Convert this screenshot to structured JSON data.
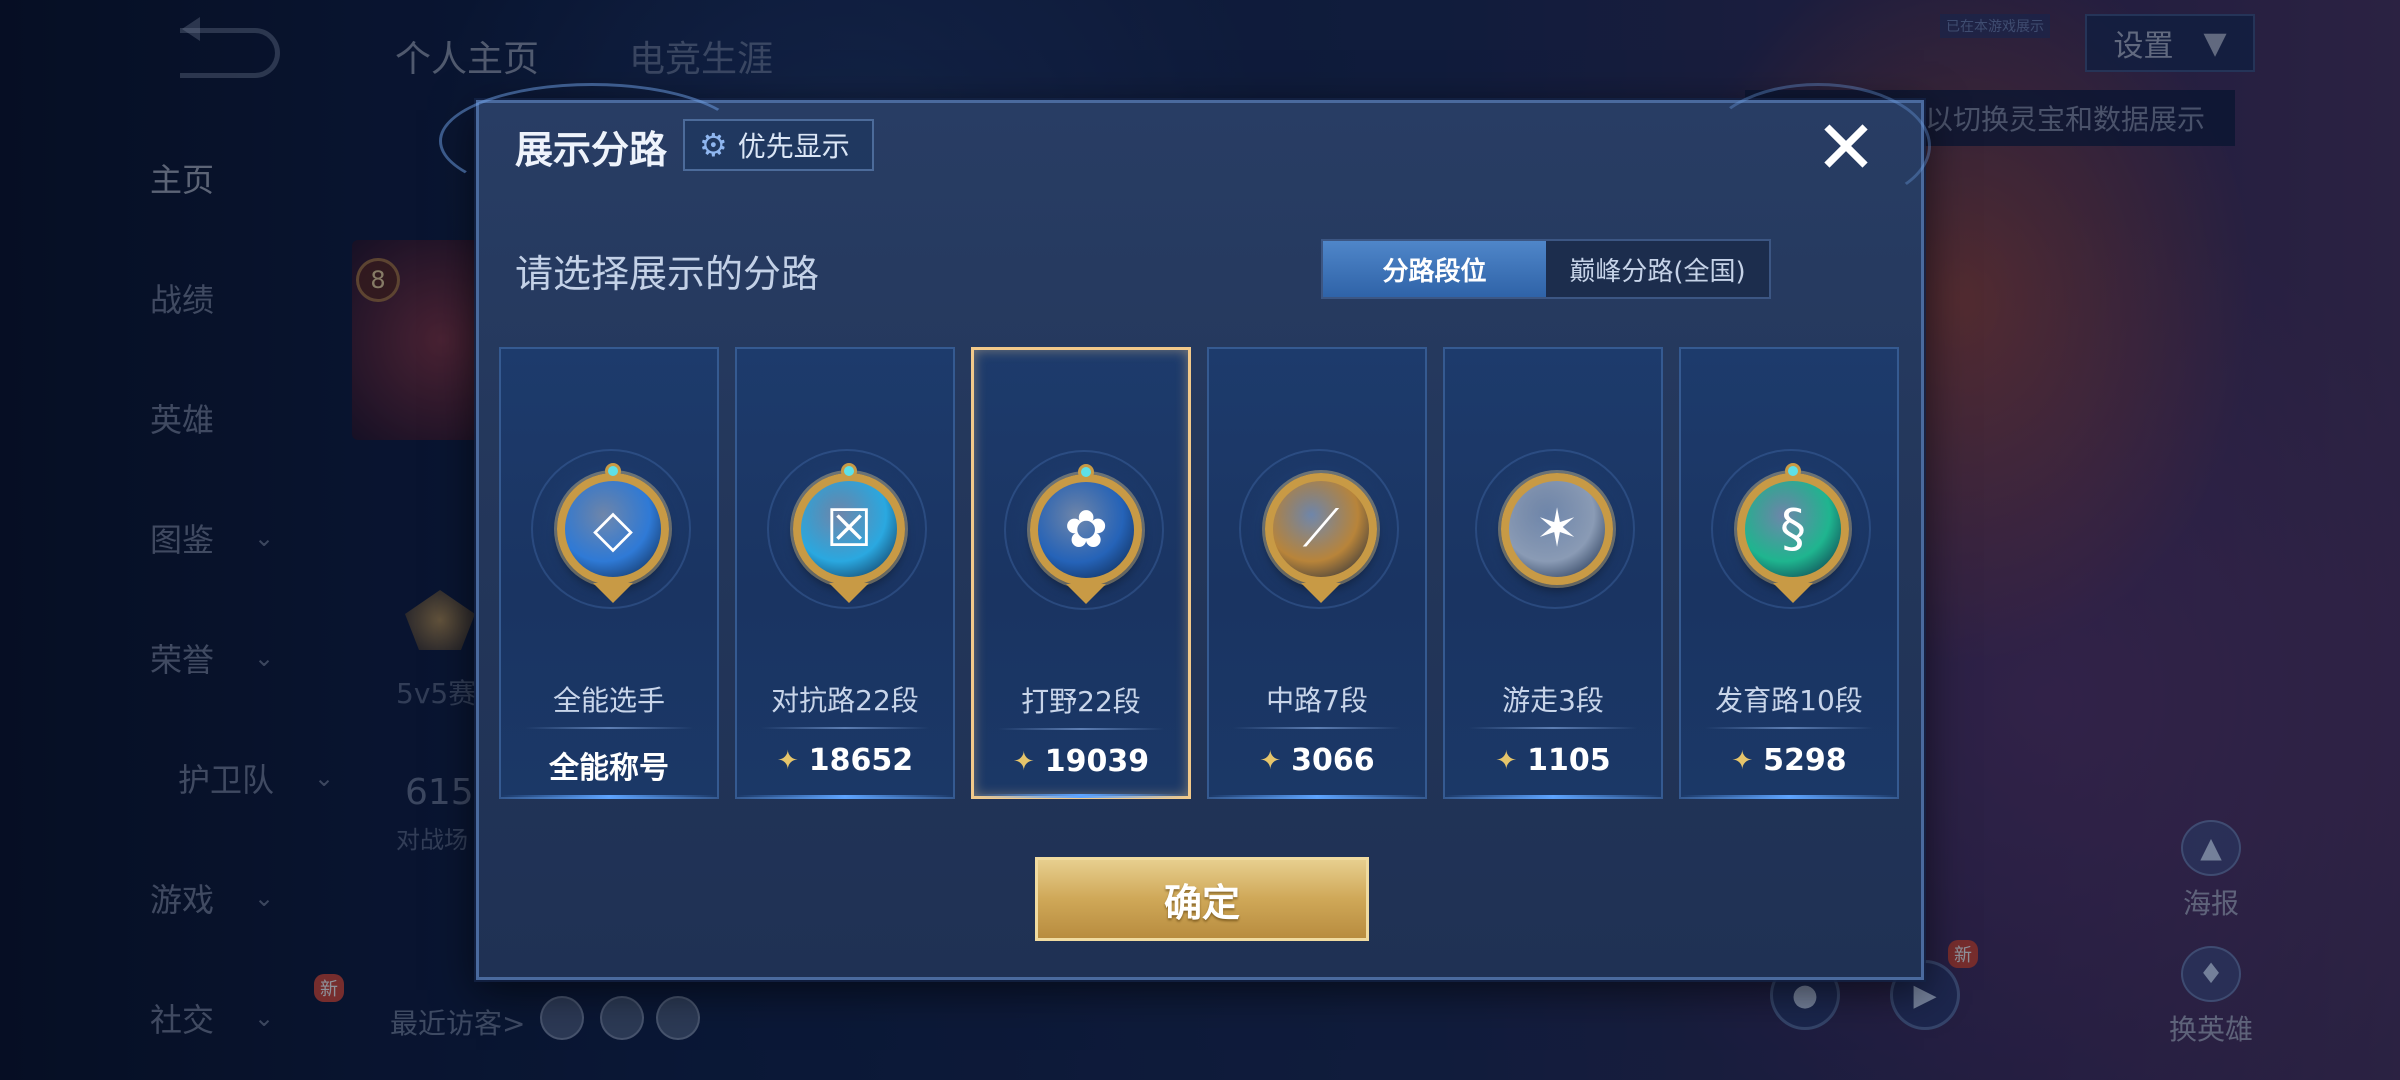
{
  "background": {
    "top_tabs": [
      {
        "label": "个人主页",
        "active": true
      },
      {
        "label": "电竞生涯",
        "active": false
      }
    ],
    "nav": [
      {
        "label": "主页",
        "chevron": false,
        "active": true
      },
      {
        "label": "战绩",
        "chevron": false
      },
      {
        "label": "英雄",
        "chevron": false
      },
      {
        "label": "图鉴",
        "chevron": true
      },
      {
        "label": "荣誉",
        "chevron": true
      },
      {
        "label": "护卫队",
        "chevron": true
      },
      {
        "label": "游戏",
        "chevron": true
      },
      {
        "label": "社交",
        "chevron": true
      }
    ],
    "settings_label": "设置",
    "hint_text": "以切换灵宝和数据展示",
    "top_badge": "已在本游戏展示",
    "level": "8",
    "mode_label": "5v5赛",
    "score_number": "615",
    "score_sub": "对战场",
    "visitors_label": "最近访客>",
    "new_tag": "新",
    "right_icons": [
      {
        "label": "海报",
        "icon": "poster-icon"
      },
      {
        "label": "换英雄",
        "icon": "swap-hero-icon"
      }
    ]
  },
  "dialog": {
    "title": "展示分路",
    "priority_label": "优先显示",
    "close_icon": "close-icon",
    "subtitle": "请选择展示的分路",
    "segment": [
      {
        "label": "分路段位",
        "active": true
      },
      {
        "label": "巅峰分路(全国)",
        "active": false
      }
    ],
    "lanes": [
      {
        "name": "全能选手",
        "score": "全能称号",
        "has_points_icon": false,
        "selected": false,
        "medal_color": "#2f7ad6",
        "icon": "all-round-icon"
      },
      {
        "name": "对抗路22段",
        "score": "18652",
        "has_points_icon": true,
        "selected": false,
        "medal_color": "#2aa8e0",
        "icon": "clash-lane-icon"
      },
      {
        "name": "打野22段",
        "score": "19039",
        "has_points_icon": true,
        "selected": true,
        "medal_color": "#2563b8",
        "icon": "jungle-icon"
      },
      {
        "name": "中路7段",
        "score": "3066",
        "has_points_icon": true,
        "selected": false,
        "medal_color": "#b8843a",
        "icon": "mid-lane-icon"
      },
      {
        "name": "游走3段",
        "score": "1105",
        "has_points_icon": true,
        "selected": false,
        "medal_color": "#8a9bb5",
        "icon": "roam-icon"
      },
      {
        "name": "发育路10段",
        "score": "5298",
        "has_points_icon": true,
        "selected": false,
        "medal_color": "#1fb58f",
        "icon": "farm-lane-icon"
      }
    ],
    "confirm_label": "确定"
  },
  "colors": {
    "accent_gold": "#cfa858",
    "selected_border": "#f2c98a",
    "segment_active": "#3f76bd"
  }
}
